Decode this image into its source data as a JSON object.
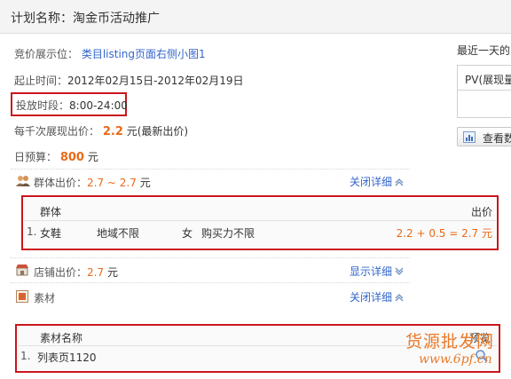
{
  "plan": {
    "title": "计划名称：淘金币活动推广"
  },
  "details": {
    "position_label": "竞价展示位：",
    "position_value": "类目listing页面右侧小图1",
    "time_label": "起止时间：",
    "time_value": "2012年02月15日-2012年02月19日",
    "schedule_label": "投放时段：",
    "schedule_value": "8:00-24:00",
    "cpm_label": "每千次展现出价：",
    "cpm_value": "2.2",
    "cpm_unit": "元(最新出价)",
    "budget_label": "日预算：",
    "budget_value": "800",
    "budget_unit": "元"
  },
  "group_bid": {
    "label": "群体出价：",
    "range": "2.7 ~ 2.7",
    "unit": "元",
    "toggle": "关闭详细",
    "table": {
      "col_group": "群体",
      "col_bid": "出价",
      "rows": [
        {
          "index": "1.",
          "gender": "女鞋",
          "region": "地域不限",
          "sex": "女",
          "power": "购买力不限",
          "bid": "2.2 + 0.5 = 2.7 元"
        }
      ]
    }
  },
  "shop_bid": {
    "label": "店铺出价：",
    "value": "2.7",
    "unit": "元",
    "toggle": "显示详细"
  },
  "materials": {
    "label": "素材",
    "toggle": "关闭详细",
    "table": {
      "col_name": "素材名称",
      "col_preview": "预览",
      "rows": [
        {
          "index": "1.",
          "name": "列表页1120"
        }
      ]
    }
  },
  "right_panel": {
    "title": "最近一天的",
    "pv_header": "PV(展现量",
    "view_button": "查看数"
  },
  "watermark": {
    "line1": "货源批发网",
    "line2": "www.6pf.cn"
  }
}
